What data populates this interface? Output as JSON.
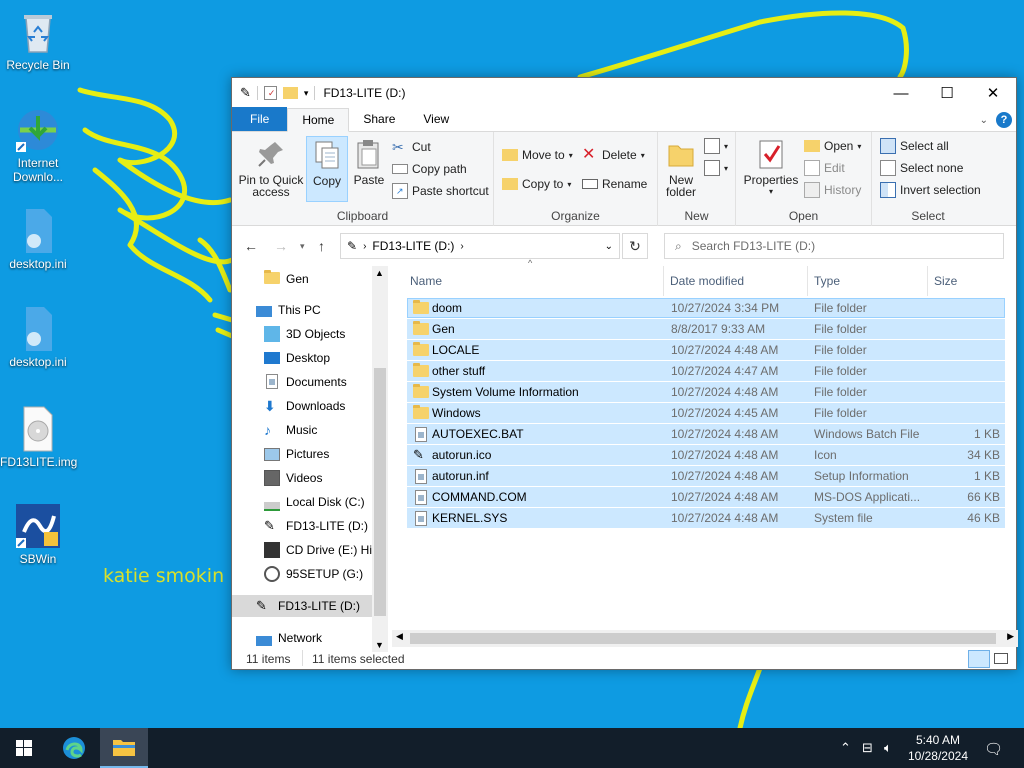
{
  "desktop": {
    "icons": [
      {
        "label": "Recycle Bin"
      },
      {
        "label": "Internet Downlo..."
      },
      {
        "label": "desktop.ini"
      },
      {
        "label": "desktop.ini"
      },
      {
        "label": "FD13LITE.img"
      },
      {
        "label": "SBWin"
      }
    ],
    "doodle_text": "katie smokin"
  },
  "window": {
    "title": "FD13-LITE (D:)",
    "controls": {
      "minimize": "—",
      "maximize": "☐",
      "close": "✕"
    },
    "tabs": [
      {
        "label": "File"
      },
      {
        "label": "Home"
      },
      {
        "label": "Share"
      },
      {
        "label": "View"
      }
    ],
    "ribbon": {
      "clipboard": {
        "group_label": "Clipboard",
        "pin_label_1": "Pin to Quick",
        "pin_label_2": "access",
        "copy": "Copy",
        "paste": "Paste",
        "cut": "Cut",
        "copy_path": "Copy path",
        "paste_shortcut": "Paste shortcut"
      },
      "organize": {
        "group_label": "Organize",
        "move_to": "Move to",
        "copy_to": "Copy to",
        "delete": "Delete",
        "rename": "Rename"
      },
      "new": {
        "group_label": "New",
        "new_folder_1": "New",
        "new_folder_2": "folder"
      },
      "open": {
        "group_label": "Open",
        "properties": "Properties",
        "open": "Open",
        "edit": "Edit",
        "history": "History"
      },
      "select": {
        "group_label": "Select",
        "select_all": "Select all",
        "select_none": "Select none",
        "invert": "Invert selection"
      }
    },
    "address": {
      "path": "FD13-LITE (D:)",
      "search_placeholder": "Search FD13-LITE (D:)"
    },
    "nav": [
      {
        "label": "Gen"
      },
      {
        "label": "This PC"
      },
      {
        "label": "3D Objects"
      },
      {
        "label": "Desktop"
      },
      {
        "label": "Documents"
      },
      {
        "label": "Downloads"
      },
      {
        "label": "Music"
      },
      {
        "label": "Pictures"
      },
      {
        "label": "Videos"
      },
      {
        "label": "Local Disk (C:)"
      },
      {
        "label": "FD13-LITE (D:)"
      },
      {
        "label": "CD Drive (E:) Hir"
      },
      {
        "label": "95SETUP (G:)"
      },
      {
        "label": "FD13-LITE (D:)"
      },
      {
        "label": "Network"
      }
    ],
    "columns": {
      "name": "Name",
      "date": "Date modified",
      "type": "Type",
      "size": "Size"
    },
    "files": [
      {
        "name": "doom",
        "date": "10/27/2024 3:34 PM",
        "type": "File folder",
        "size": "",
        "icon": "folder-icon"
      },
      {
        "name": "Gen",
        "date": "8/8/2017 9:33 AM",
        "type": "File folder",
        "size": "",
        "icon": "folder-icon"
      },
      {
        "name": "LOCALE",
        "date": "10/27/2024 4:48 AM",
        "type": "File folder",
        "size": "",
        "icon": "folder-icon"
      },
      {
        "name": "other stuff",
        "date": "10/27/2024 4:47 AM",
        "type": "File folder",
        "size": "",
        "icon": "folder-icon"
      },
      {
        "name": "System Volume Information",
        "date": "10/27/2024 4:48 AM",
        "type": "File folder",
        "size": "",
        "icon": "folder-icon"
      },
      {
        "name": "Windows",
        "date": "10/27/2024 4:45 AM",
        "type": "File folder",
        "size": "",
        "icon": "folder-icon"
      },
      {
        "name": "AUTOEXEC.BAT",
        "date": "10/27/2024 4:48 AM",
        "type": "Windows Batch File",
        "size": "1 KB",
        "icon": "batch-file-icon"
      },
      {
        "name": "autorun.ico",
        "date": "10/27/2024 4:48 AM",
        "type": "Icon",
        "size": "34 KB",
        "icon": "usb-drive-icon"
      },
      {
        "name": "autorun.inf",
        "date": "10/27/2024 4:48 AM",
        "type": "Setup Information",
        "size": "1 KB",
        "icon": "settings-file-icon"
      },
      {
        "name": "COMMAND.COM",
        "date": "10/27/2024 4:48 AM",
        "type": "MS-DOS Applicati...",
        "size": "66 KB",
        "icon": "app-file-icon"
      },
      {
        "name": "KERNEL.SYS",
        "date": "10/27/2024 4:48 AM",
        "type": "System file",
        "size": "46 KB",
        "icon": "system-file-icon"
      }
    ],
    "status": {
      "count": "11 items",
      "selected": "11 items selected"
    }
  },
  "taskbar": {
    "time": "5:40 AM",
    "date": "10/28/2024"
  },
  "colors": {
    "desktop": "#0e9be2",
    "doodle": "#e6ee14",
    "selection": "#cce8ff",
    "file_tab": "#1979ca",
    "taskbar": "#121e2a"
  }
}
